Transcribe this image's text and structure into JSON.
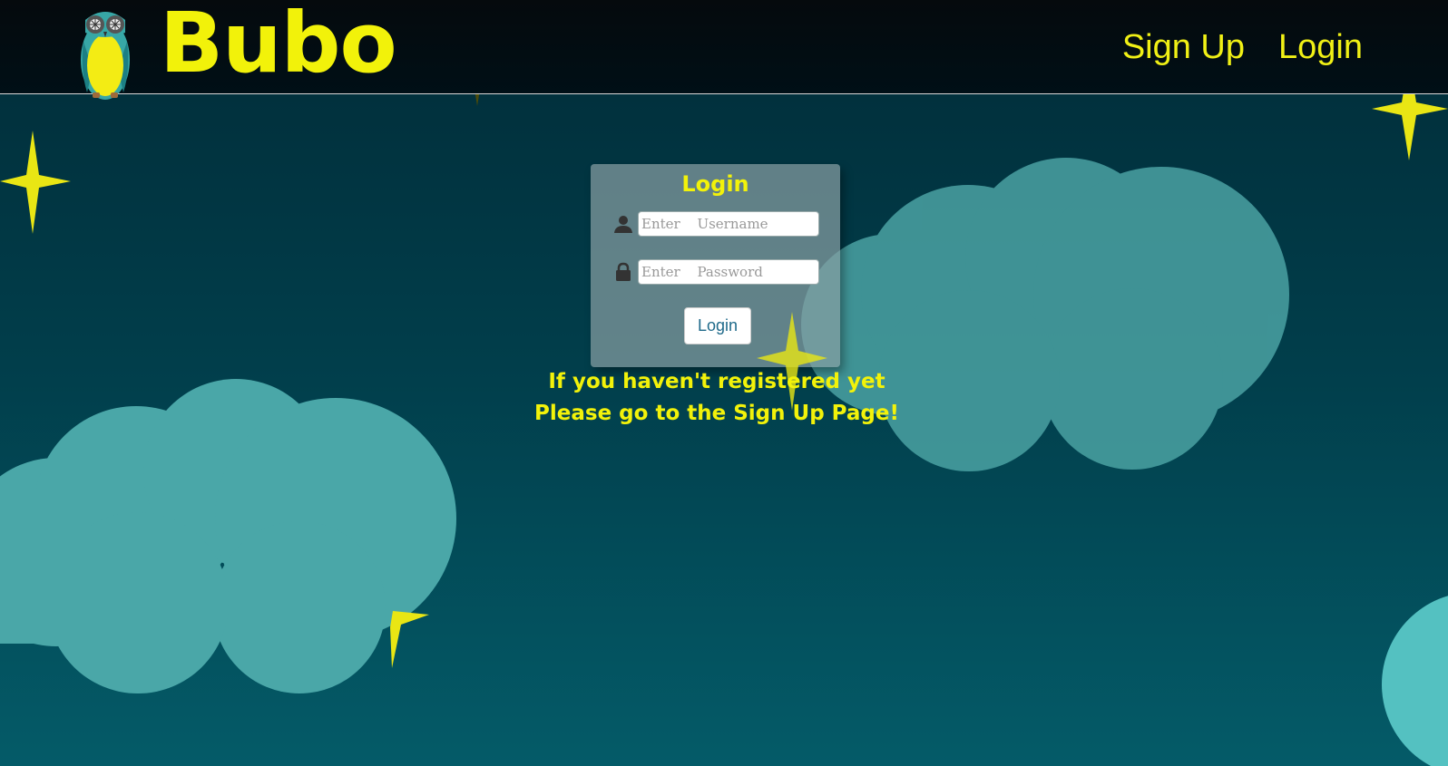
{
  "header": {
    "brand_name": "Bubo",
    "logo_icon": "owl-icon",
    "nav": [
      {
        "label": "Sign Up"
      },
      {
        "label": "Login"
      }
    ]
  },
  "login_form": {
    "title": "Login",
    "username": {
      "placeholder": "Enter Username",
      "value": "",
      "icon": "user-icon"
    },
    "password": {
      "placeholder": "Enter Password",
      "value": "",
      "icon": "lock-icon"
    },
    "submit_label": "Login"
  },
  "register_message": {
    "line1": "If you haven't registered yet",
    "line2": "Please go to the Sign Up Page!"
  },
  "colors": {
    "accent": "#f2f20a",
    "header_bg": "#000f16",
    "cloud": "#4aa7a8",
    "sky_top": "#012c38",
    "sky_bottom": "#045b68"
  }
}
